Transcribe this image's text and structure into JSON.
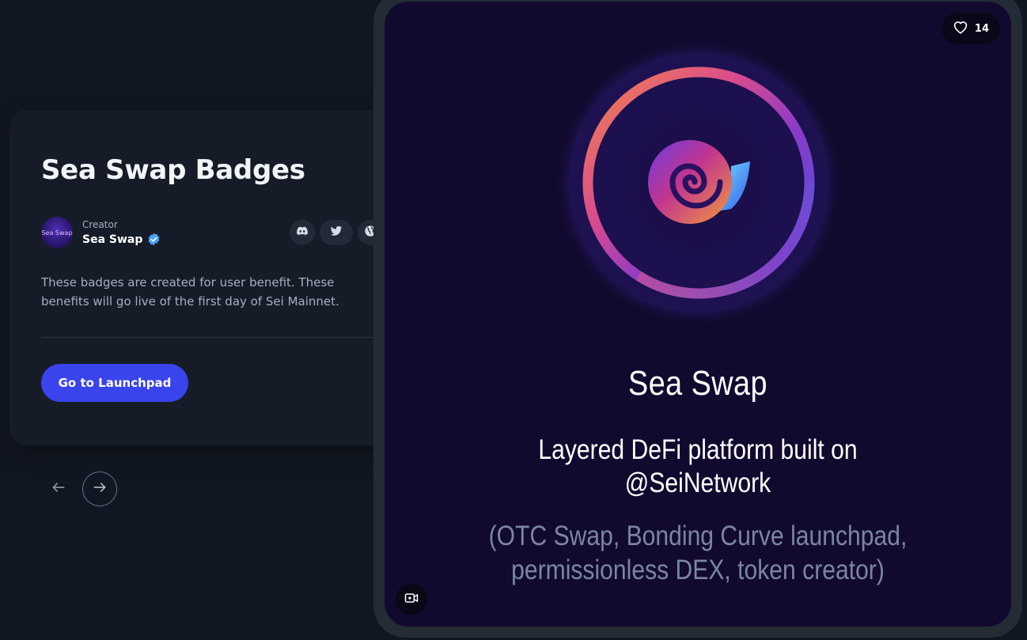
{
  "card": {
    "title": "Sea Swap Badges",
    "creator_label": "Creator",
    "creator_name": "Sea Swap",
    "avatar_text": "Sea Swap",
    "description": "These badges are created for user benefit. These benefits will go live of the first day of Sei Mainnet.",
    "launch_button": "Go to Launchpad",
    "socials": [
      "discord-icon",
      "twitter-icon",
      "globe-icon"
    ]
  },
  "pager": {
    "prev_icon": "arrow-left-icon",
    "next_icon": "arrow-right-icon"
  },
  "preview": {
    "likes": "14",
    "title": "Sea Swap",
    "tagline": "Layered DeFi platform built on @SeiNetwork",
    "features": "(OTC Swap, Bonding Curve launchpad, permissionless DEX, token creator)"
  },
  "colors": {
    "background": "#111722",
    "card": "#151c28",
    "accent": "#3a44ec",
    "preview_bg": "#120a2e",
    "verified": "#4aa3f5"
  }
}
